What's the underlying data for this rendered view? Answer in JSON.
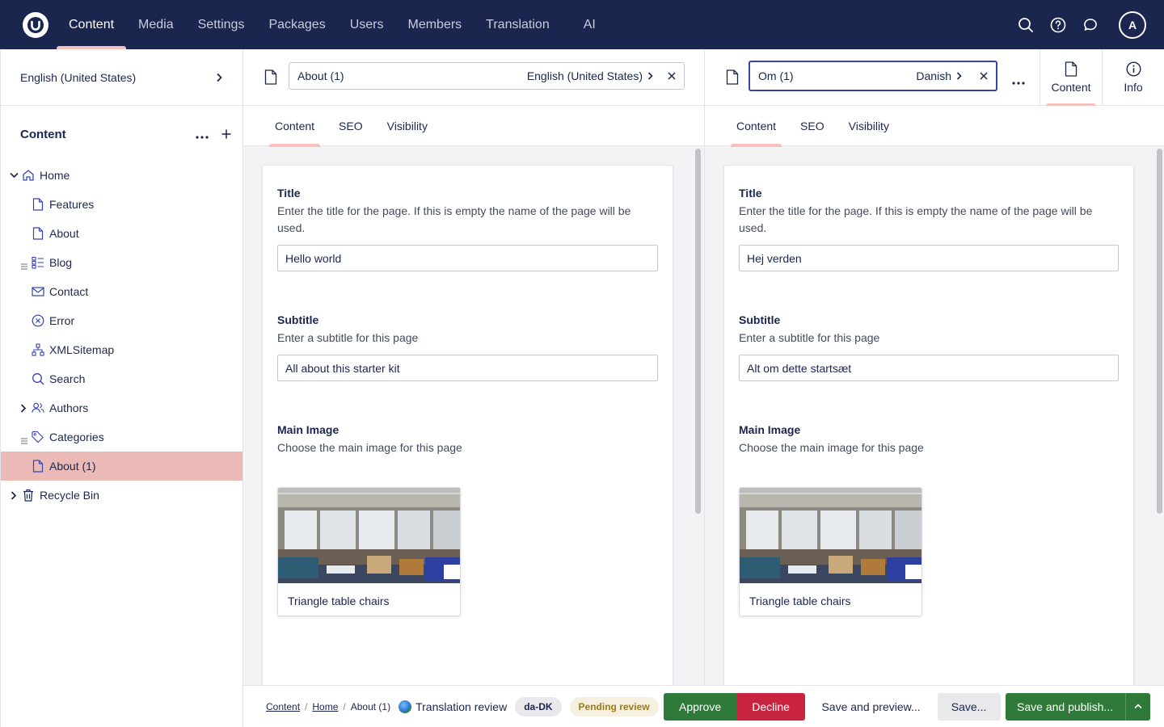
{
  "topnav": {
    "items": [
      {
        "label": "Content"
      },
      {
        "label": "Media"
      },
      {
        "label": "Settings"
      },
      {
        "label": "Packages"
      },
      {
        "label": "Users"
      },
      {
        "label": "Members"
      },
      {
        "label": "Translation"
      },
      {
        "label": "AI"
      }
    ],
    "active": "Content",
    "avatar_initial": "A"
  },
  "sidebar": {
    "language": "English (United States)",
    "section_title": "Content",
    "tree": [
      {
        "label": "Home",
        "icon": "home-icon"
      },
      {
        "label": "Features",
        "icon": "document-icon"
      },
      {
        "label": "About",
        "icon": "document-icon"
      },
      {
        "label": "Blog",
        "icon": "list-icon"
      },
      {
        "label": "Contact",
        "icon": "mail-icon"
      },
      {
        "label": "Error",
        "icon": "error-circle-icon"
      },
      {
        "label": "XMLSitemap",
        "icon": "sitemap-icon"
      },
      {
        "label": "Search",
        "icon": "search-icon"
      },
      {
        "label": "Authors",
        "icon": "users-icon"
      },
      {
        "label": "Categories",
        "icon": "tag-icon"
      },
      {
        "label": "About (1)",
        "icon": "document-icon"
      },
      {
        "label": "Recycle Bin",
        "icon": "trash-icon"
      }
    ],
    "selected": "About (1)"
  },
  "left_pane": {
    "name": "About (1)",
    "language": "English (United States)",
    "tabs": [
      "Content",
      "SEO",
      "Visibility"
    ],
    "active_tab": "Content",
    "props": {
      "title": {
        "label": "Title",
        "desc": "Enter the title for the page. If this is empty the name of the page will be used.",
        "value": "Hello world"
      },
      "subtitle": {
        "label": "Subtitle",
        "desc": "Enter a subtitle for this page",
        "value": "All about this starter kit"
      },
      "image": {
        "label": "Main Image",
        "desc": "Choose the main image for this page",
        "caption": "Triangle table chairs"
      }
    }
  },
  "right_pane": {
    "name": "Om (1)",
    "language": "Danish",
    "tabs": [
      "Content",
      "SEO",
      "Visibility"
    ],
    "active_tab": "Content",
    "views": [
      {
        "label": "Content"
      },
      {
        "label": "Info"
      }
    ],
    "props": {
      "title": {
        "label": "Title",
        "desc": "Enter the title for the page. If this is empty the name of the page will be used.",
        "value": "Hej verden"
      },
      "subtitle": {
        "label": "Subtitle",
        "desc": "Enter a subtitle for this page",
        "value": "Alt om dette startsæt"
      },
      "image": {
        "label": "Main Image",
        "desc": "Choose the main image for this page",
        "caption": "Triangle table chairs"
      }
    }
  },
  "footer": {
    "breadcrumbs": [
      "Content",
      "Home",
      "About (1)"
    ],
    "translation_review": "Translation review",
    "culture": "da-DK",
    "status": "Pending review",
    "approve": "Approve",
    "decline": "Decline",
    "save_preview": "Save and preview...",
    "save": "Save...",
    "save_publish": "Save and publish..."
  },
  "colors": {
    "header_bg": "#1b264f",
    "accent": "#f5c1bc",
    "selected_row": "#ebbab6",
    "approve": "#2f7a3b",
    "decline": "#c9243f"
  }
}
